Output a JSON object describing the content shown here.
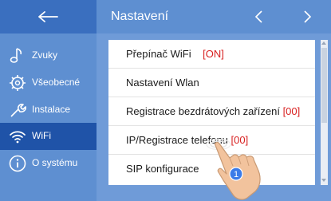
{
  "header": {
    "title": "Nastavení",
    "prev_icon": "chevron-left-icon",
    "next_icon": "chevron-right-icon"
  },
  "sidebar": {
    "back_icon": "arrow-left-icon",
    "items": [
      {
        "label": "Zvuky",
        "icon": "music-note-icon",
        "active": false
      },
      {
        "label": "Všeobecné",
        "icon": "gear-icon",
        "active": false
      },
      {
        "label": "Instalace",
        "icon": "wrench-icon",
        "active": false
      },
      {
        "label": "WiFi",
        "icon": "wifi-icon",
        "active": true
      },
      {
        "label": "O systému",
        "icon": "info-icon",
        "active": false
      }
    ]
  },
  "menu": {
    "items": [
      {
        "label": "Přepínač WiFi",
        "value": "[ON]"
      },
      {
        "label": "Nastavení Wlan",
        "value": ""
      },
      {
        "label": "Registrace bezdrátových zařízení",
        "value": "[00]"
      },
      {
        "label": "IP/Registrace telefonu",
        "value": "[00]"
      },
      {
        "label": "SIP konfigurace",
        "value": ""
      }
    ]
  },
  "pointer": {
    "badge": "1"
  },
  "colors": {
    "sidebar": "#5e8fd1",
    "active": "#1f53a8",
    "value": "#d81f1f",
    "badge": "#3b7be8"
  }
}
